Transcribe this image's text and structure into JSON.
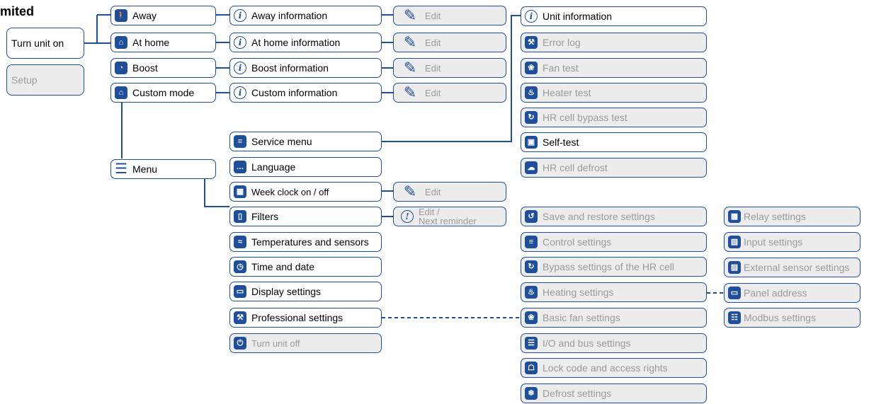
{
  "header": {
    "title": "mited"
  },
  "left": {
    "turn_unit_on": "Turn unit on",
    "setup": "Setup"
  },
  "modes": [
    {
      "label": "Away",
      "info": "Away information",
      "edit": "Edit"
    },
    {
      "label": "At home",
      "info": "At home information",
      "edit": "Edit"
    },
    {
      "label": "Boost",
      "info": "Boost information",
      "edit": "Edit"
    },
    {
      "label": "Custom mode",
      "info": "Custom information",
      "edit": "Edit"
    }
  ],
  "menu": {
    "label": "Menu"
  },
  "menu_items": [
    "Service menu",
    "Language",
    "Week clock on / off",
    "Filters",
    "Temperatures and sensors",
    "Time and date",
    "Display settings",
    "Professional settings",
    "Turn unit off"
  ],
  "week_clock_edit": "Edit",
  "filters_edit": {
    "line1": "Edit /",
    "line2": "Next reminder"
  },
  "service_items": [
    "Unit information",
    "Error log",
    "Fan test",
    "Heater test",
    "HR cell bypass test",
    "Self-test",
    "HR cell defrost"
  ],
  "professional_items": [
    "Save and restore settings",
    "Control settings",
    "Bypass settings of the HR cell",
    "Heating settings",
    "Basic fan settings",
    "I/O and bus settings",
    "Lock code and access rights",
    "Defrost settings"
  ],
  "heating_items": [
    "Relay settings",
    "Input settings",
    "External sensor settings",
    "Panel address",
    "Modbus settings"
  ],
  "icons": {
    "modes": [
      "walk-icon",
      "home-icon",
      "boost-icon",
      "custom-home-icon"
    ],
    "info": "info-icon",
    "edit": "pencil-icon",
    "menu": "hamburger-icon"
  },
  "colors": {
    "accent": "#1f4f9a",
    "disabled_bg": "#ececec",
    "disabled_text": "#9a9a9a"
  }
}
